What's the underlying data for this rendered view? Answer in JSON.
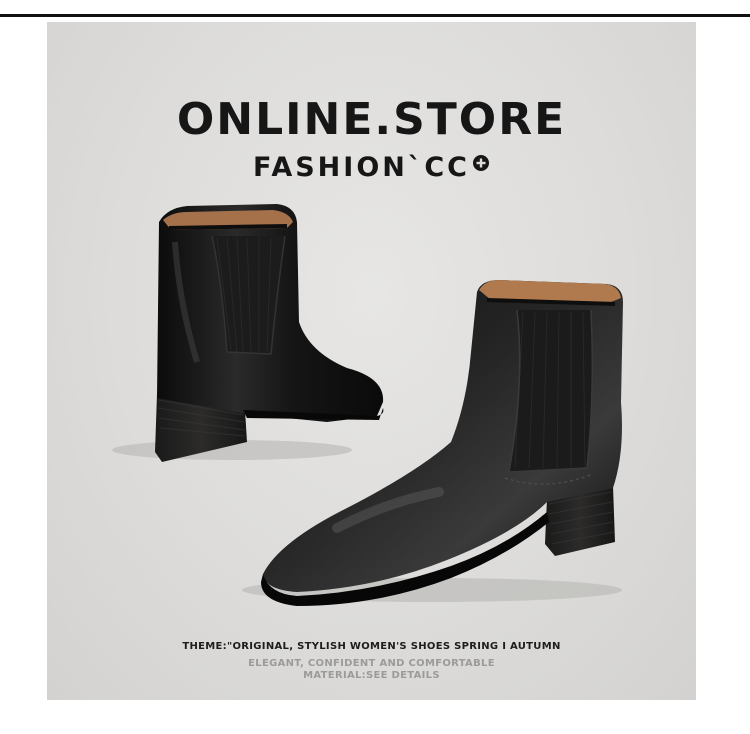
{
  "header": {
    "title": "ONLINE.STORE",
    "subtitle": "FASHION`CC"
  },
  "icons": {
    "subtitle_badge": "plus-circle-icon"
  },
  "image": {
    "subject": "pair-of-black-leather-chelsea-ankle-boots"
  },
  "captions": {
    "theme": "THEME:\"ORIGINAL, STYLISH WOMEN'S SHOES SPRING I AUTUMN",
    "line2": "ELEGANT, CONFIDENT AND COMFORTABLE",
    "line3": "MATERIAL:SEE DETAILS"
  },
  "colors": {
    "background": "#dddcda",
    "text": "#161616",
    "muted": "#9c9b99",
    "leather": "#141414",
    "lining": "#b07a4e"
  }
}
